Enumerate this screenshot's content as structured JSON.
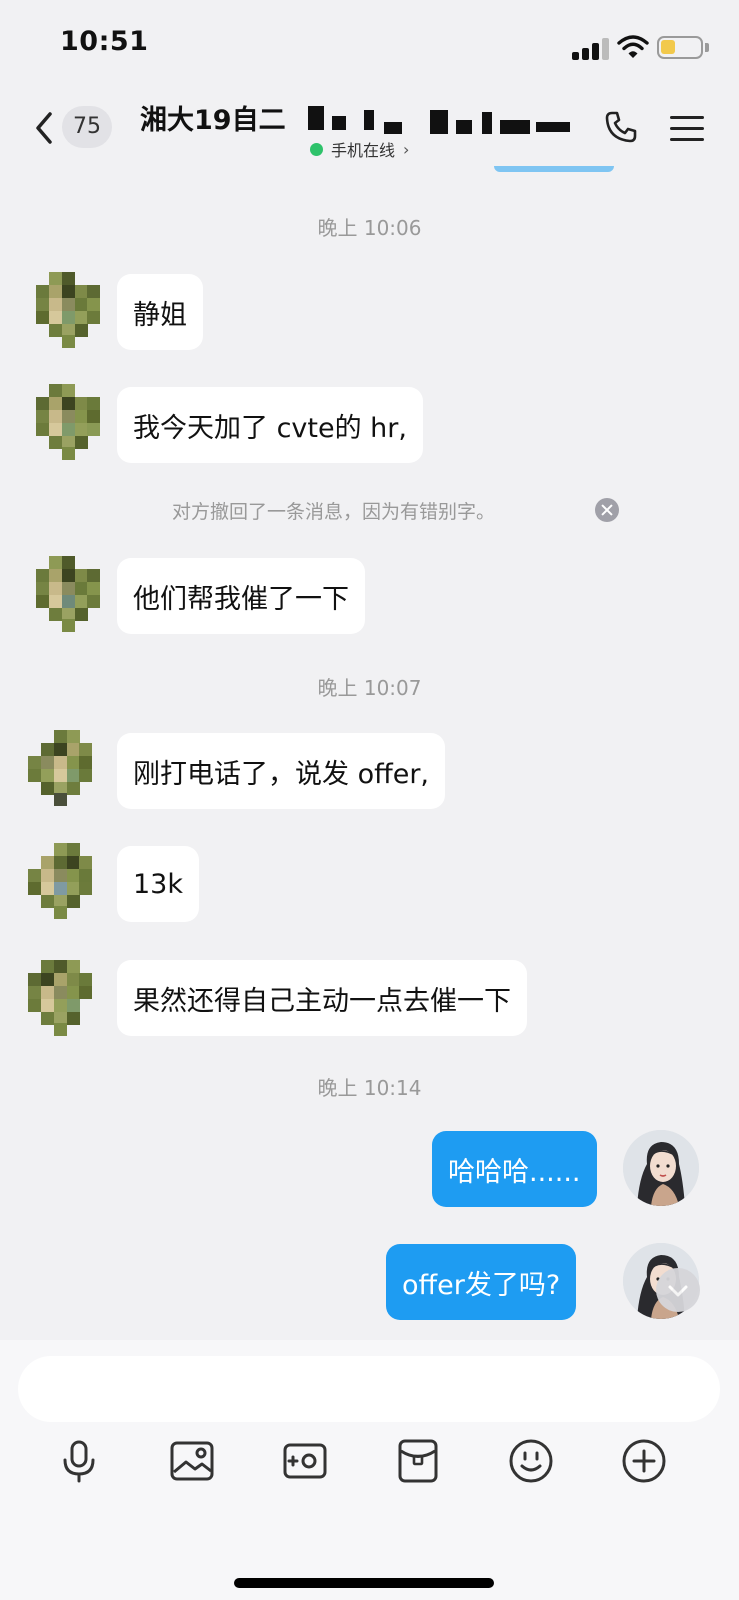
{
  "status_bar": {
    "time": "10:51"
  },
  "header": {
    "unread_count": "75",
    "title": "湘大19自二",
    "online_status": "手机在线",
    "online_chevron": "›"
  },
  "messages": {
    "time_1": "晚上 10:06",
    "msg_1": "静姐",
    "msg_2": "我今天加了 cvte的 hr,",
    "recall_notice": "对方撤回了一条消息，因为有错别字。",
    "msg_3": "他们帮我催了一下",
    "time_2": "晚上 10:07",
    "msg_4": "刚打电话了，说发 offer,",
    "msg_5": "13k",
    "msg_6": "果然还得自己主动一点去催一下",
    "time_3": "晚上 10:14",
    "my_msg_1": "哈哈哈......",
    "my_msg_2": "offer发了吗?"
  },
  "toolbar": {
    "icons": [
      "microphone-icon",
      "image-icon",
      "camera-icon",
      "red-packet-icon",
      "emoji-icon",
      "plus-icon"
    ]
  },
  "colors": {
    "my_bubble": "#1e9cf2",
    "online_dot": "#2ec26a",
    "background": "#f1f1f3"
  }
}
